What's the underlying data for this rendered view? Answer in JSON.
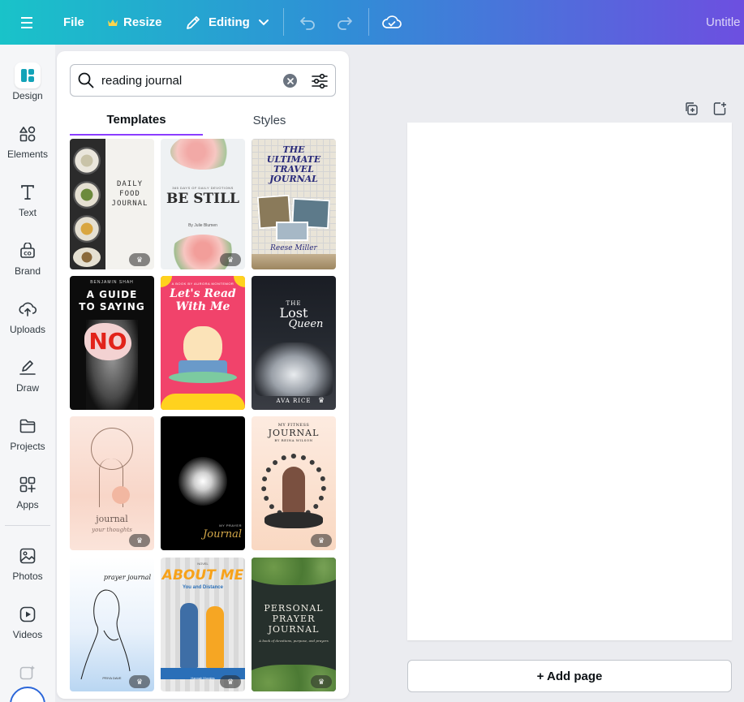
{
  "topbar": {
    "file": "File",
    "resize": "Resize",
    "editing": "Editing",
    "title": "Untitle"
  },
  "rail": {
    "items": [
      {
        "label": "Design",
        "icon": "design-icon"
      },
      {
        "label": "Elements",
        "icon": "elements-icon"
      },
      {
        "label": "Text",
        "icon": "text-icon"
      },
      {
        "label": "Brand",
        "icon": "brand-icon"
      },
      {
        "label": "Uploads",
        "icon": "upload-cloud-icon"
      },
      {
        "label": "Draw",
        "icon": "draw-pen-icon"
      },
      {
        "label": "Projects",
        "icon": "folder-icon"
      },
      {
        "label": "Apps",
        "icon": "apps-grid-icon"
      },
      {
        "label": "Photos",
        "icon": "photo-icon"
      },
      {
        "label": "Videos",
        "icon": "video-play-icon"
      }
    ]
  },
  "search": {
    "value": "reading journal"
  },
  "tabs": {
    "templates": "Templates",
    "styles": "Styles"
  },
  "templates": {
    "t1": {
      "top": "DAILY",
      "mid": "FOOD",
      "bot": "JOURNAL"
    },
    "t2": {
      "sub": "365 DAYS OF DAILY DEVOTIONS",
      "title": "BE STILL",
      "by": "By Julie Blumen"
    },
    "t3": {
      "l1": "THE",
      "l2": "ULTIMATE",
      "l3": "TRAVEL",
      "l4": "JOURNAL",
      "sig": "Reese Miller"
    },
    "t4": {
      "author": "BENJAMIN SHAH",
      "l1": "A GUIDE",
      "l2": "TO SAYING",
      "no": "NO"
    },
    "t5": {
      "sub": "A BOOK BY AURORA MONTEMOR",
      "l1": "Let's Read",
      "l2": "With Me"
    },
    "t6": {
      "l1": "THE",
      "l2": "Lost",
      "l3": "Queen",
      "author": "AVA RICE"
    },
    "t7": {
      "l1": "journal",
      "l2": "your thoughts"
    },
    "t8": {
      "l1": "MY PRAYER",
      "l2": "Journal"
    },
    "t9": {
      "l1": "MY FITNESS",
      "l2": "JOURNAL",
      "by": "BY REINA WILSON"
    },
    "t10": {
      "l1": "prayer journal",
      "by": "PRIYA DAVE"
    },
    "t11": {
      "sub": "NOVEL",
      "l1": "ABOUT ME",
      "l2": "You and Distance",
      "by": "Hannah Morales"
    },
    "t12": {
      "l1": "PERSONAL",
      "l2": "PRAYER",
      "l3": "JOURNAL",
      "sub": "A book of devotions, purpose, and prayers"
    }
  },
  "canvas": {
    "add_page": "+ Add page"
  },
  "colors": {
    "accent": "#8b3dff",
    "topbar_start": "#19c3c9",
    "topbar_end": "#6d4fe0"
  }
}
